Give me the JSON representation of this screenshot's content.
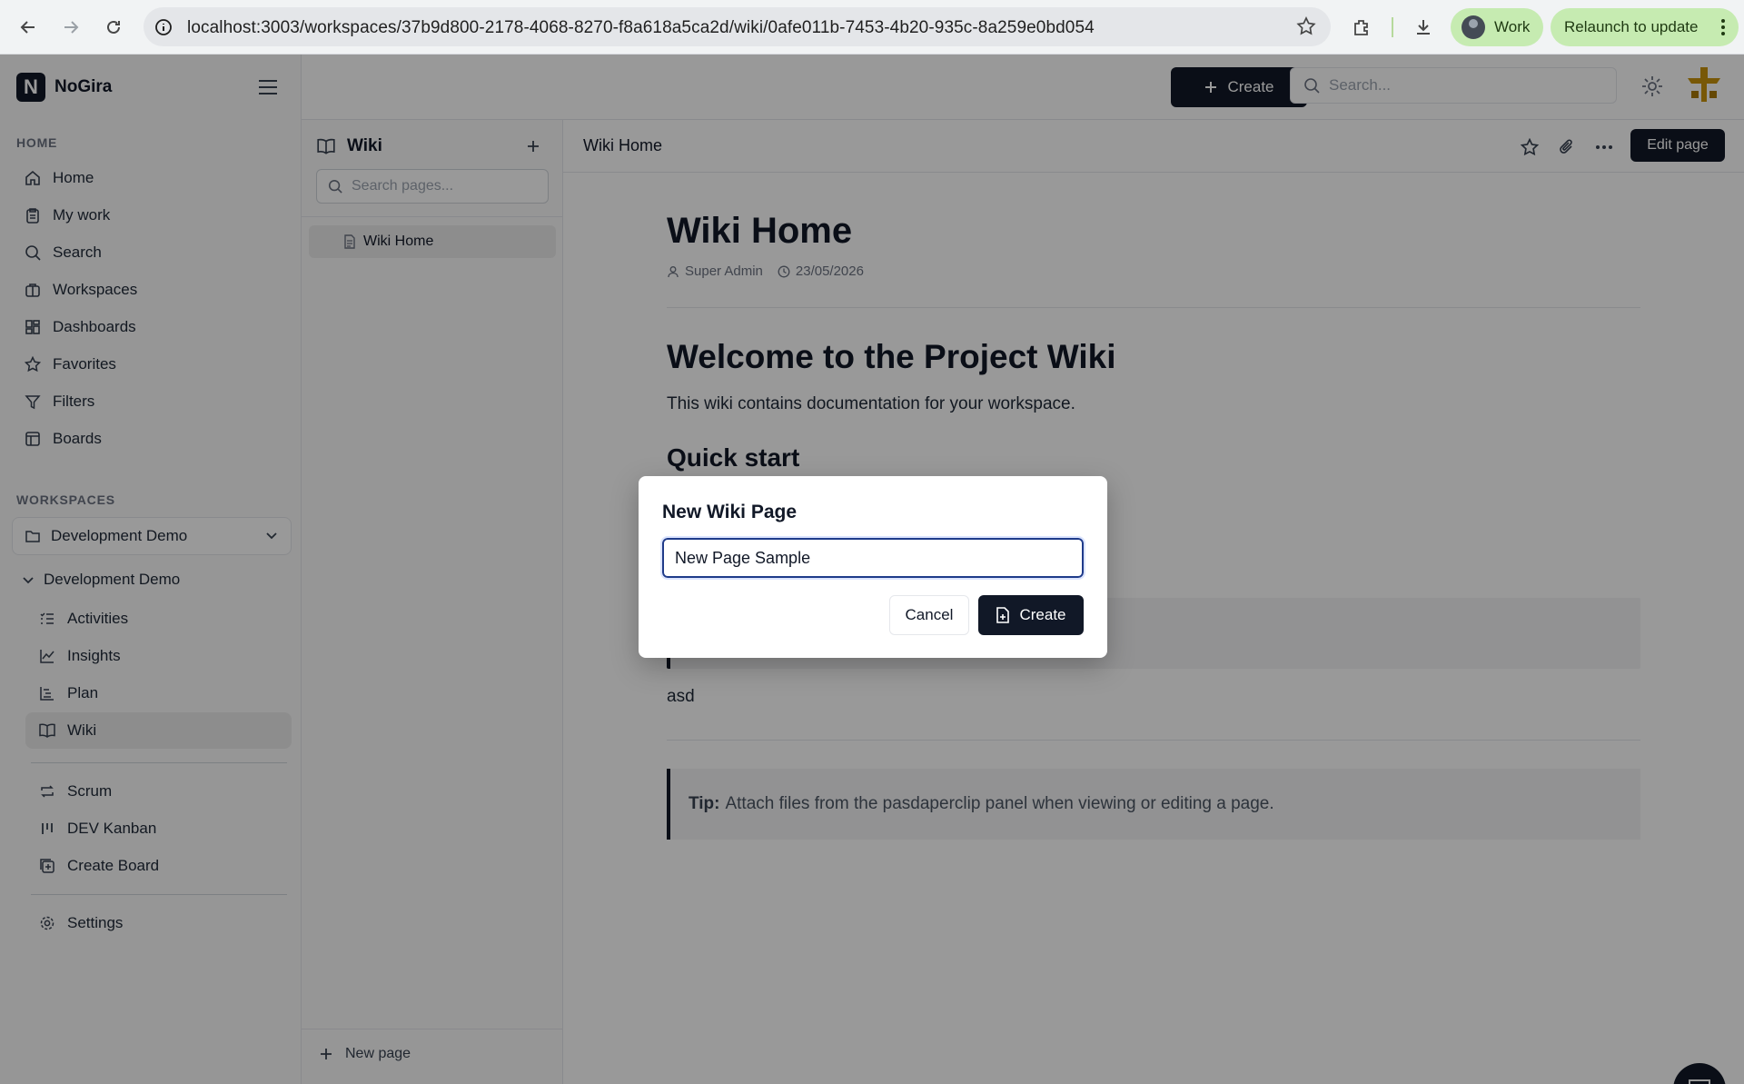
{
  "browser": {
    "url": "localhost:3003/workspaces/37b9d800-2178-4068-8270-f8a618a5ca2d/wiki/0afe011b-7453-4b20-935c-8a259e0bd054",
    "profile_label": "Work",
    "relaunch_label": "Relaunch to update",
    "accent": "#c6ebb1"
  },
  "app": {
    "name": "NoGira",
    "logo_letter": "N"
  },
  "sidebar": {
    "home_section": "HOME",
    "items": [
      {
        "label": "Home",
        "icon": "home-icon"
      },
      {
        "label": "My work",
        "icon": "clipboard-icon"
      },
      {
        "label": "Search",
        "icon": "search-icon"
      },
      {
        "label": "Workspaces",
        "icon": "briefcase-icon"
      },
      {
        "label": "Dashboards",
        "icon": "dashboard-icon"
      },
      {
        "label": "Favorites",
        "icon": "star-icon"
      },
      {
        "label": "Filters",
        "icon": "filter-icon"
      },
      {
        "label": "Boards",
        "icon": "board-icon"
      }
    ],
    "workspaces_section": "WORKSPACES",
    "workspace_selected": "Development Demo",
    "workspace_tree_label": "Development Demo",
    "workspace_items": [
      {
        "label": "Activities",
        "icon": "list-icon"
      },
      {
        "label": "Insights",
        "icon": "chart-line-icon"
      },
      {
        "label": "Plan",
        "icon": "timeline-icon"
      },
      {
        "label": "Wiki",
        "icon": "book-icon",
        "active": true
      }
    ],
    "board_items": [
      {
        "label": "Scrum",
        "icon": "repeat-icon"
      },
      {
        "label": "DEV Kanban",
        "icon": "kanban-icon"
      },
      {
        "label": "Create Board",
        "icon": "add-board-icon"
      }
    ],
    "settings_label": "Settings"
  },
  "topbar": {
    "create_label": "Create",
    "search_placeholder": "Search..."
  },
  "wiki_panel": {
    "title": "Wiki",
    "search_placeholder": "Search pages...",
    "pages": [
      "Wiki Home"
    ],
    "new_page_label": "New page"
  },
  "content": {
    "header_title": "Wiki Home",
    "edit_label": "Edit page",
    "page_title": "Wiki Home",
    "author": "Super Admin",
    "date": "23/05/2026",
    "heading": "Welcome to the Project Wiki",
    "intro": "This wiki contains documentation for your workspace.",
    "subheading": "Quick start",
    "paragraph": "asd",
    "tip_label": "Tip:",
    "tip_text": "Attach files from the pasdaperclip panel when viewing or editing a page."
  },
  "modal": {
    "title": "New Wiki Page",
    "input_value": "New Page Sample",
    "cancel_label": "Cancel",
    "create_label": "Create"
  }
}
